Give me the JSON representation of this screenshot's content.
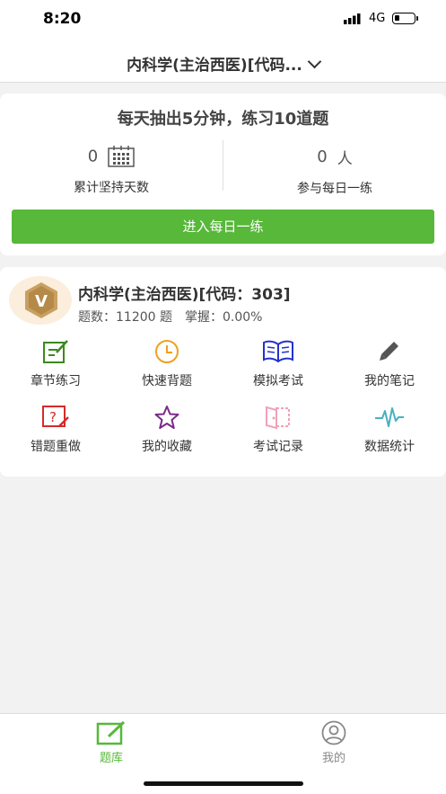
{
  "status_bar": {
    "time": "8:20",
    "network": "4G"
  },
  "header": {
    "title": "内科学(主治西医)[代码..."
  },
  "daily": {
    "slogan": "每天抽出5分钟，练习10道题",
    "days_value": "0",
    "days_label": "累计坚持天数",
    "people_value": "0",
    "people_unit": "人",
    "people_label": "参与每日一练",
    "button_label": "进入每日一练"
  },
  "subject": {
    "vip_letter": "V",
    "name": "内科学(主治西医)[代码：303]",
    "count_text": "题数：11200 题",
    "mastery_text": "掌握：0.00%"
  },
  "features": [
    {
      "label": "章节练习",
      "icon": "edit-icon",
      "color": "#3a8a1e"
    },
    {
      "label": "快速背题",
      "icon": "clock-icon",
      "color": "#f0a020"
    },
    {
      "label": "模拟考试",
      "icon": "book-icon",
      "color": "#2233cc"
    },
    {
      "label": "我的笔记",
      "icon": "pencil-icon",
      "color": "#555555"
    },
    {
      "label": "错题重做",
      "icon": "question-icon",
      "color": "#d62a2a"
    },
    {
      "label": "我的收藏",
      "icon": "star-icon",
      "color": "#7a2a8a"
    },
    {
      "label": "考试记录",
      "icon": "record-icon",
      "color": "#f2a0b8"
    },
    {
      "label": "数据统计",
      "icon": "pulse-icon",
      "color": "#4ab0c0"
    }
  ],
  "tabbar": {
    "tabs": [
      {
        "label": "题库",
        "icon": "edit-square-icon",
        "active": true
      },
      {
        "label": "我的",
        "icon": "user-icon",
        "active": false
      }
    ],
    "active_color": "#57b83a",
    "inactive_color": "#888888"
  }
}
